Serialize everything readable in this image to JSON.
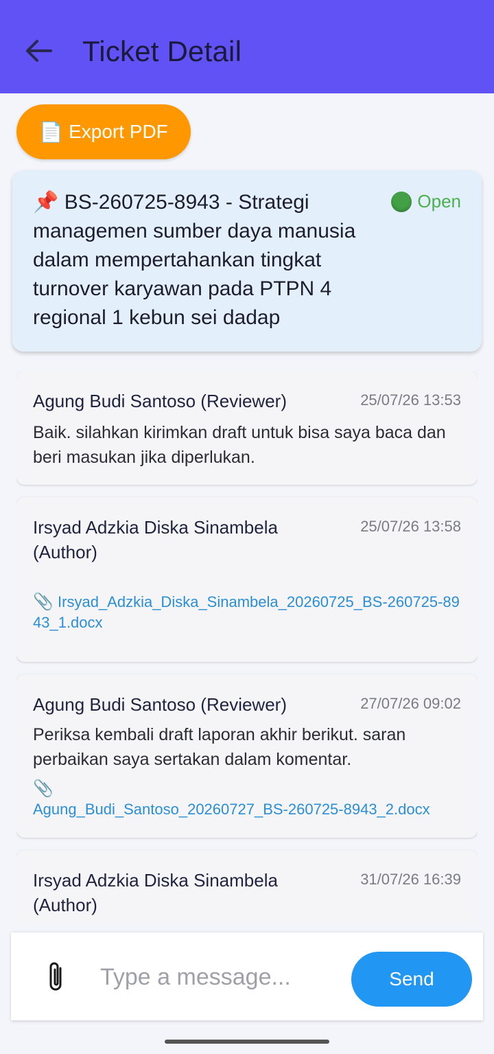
{
  "appbar": {
    "title": "Ticket Detail"
  },
  "export": {
    "icon": "📄",
    "label": "Export PDF"
  },
  "ticket": {
    "pin": "📌",
    "title": "BS-260725-8943 - Strategi managemen sumber daya manusia dalam mempertahankan tingkat turnover karyawan pada PTPN 4 regional 1 kebun sei dadap",
    "status": "Open",
    "status_color": "#4caf50"
  },
  "messages": [
    {
      "author": "Agung Budi Santoso (Reviewer)",
      "time": "25/07/26 13:53",
      "text": "Baik. silahkan kirimkan draft untuk bisa saya baca dan beri masukan jika diperlukan.",
      "attachment": ""
    },
    {
      "author": "Irsyad Adzkia Diska Sinambela (Author)",
      "time": "25/07/26 13:58",
      "text": "",
      "attachment": "Irsyad_Adzkia_Diska_Sinambela_20260725_BS-260725-8943_1.docx"
    },
    {
      "author": "Agung Budi Santoso (Reviewer)",
      "time": "27/07/26 09:02",
      "text": "Periksa kembali draft laporan akhir berikut. saran perbaikan saya sertakan dalam komentar.",
      "attachment": "Agung_Budi_Santoso_20260727_BS-260725-8943_2.docx"
    },
    {
      "author": "Irsyad Adzkia Diska Sinambela (Author)",
      "time": "31/07/26 16:39",
      "text": "",
      "attachment": ""
    }
  ],
  "composer": {
    "placeholder": "Type a message...",
    "send_label": "Send"
  },
  "colors": {
    "appbar": "#6152f5",
    "export": "#ff9800",
    "send": "#2196f3",
    "link": "#2a8fd6"
  }
}
